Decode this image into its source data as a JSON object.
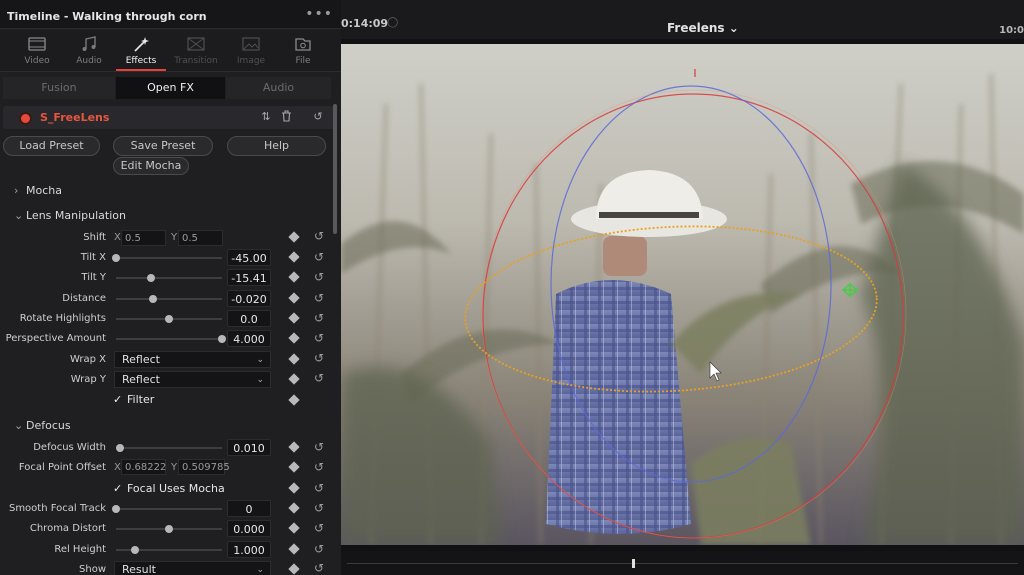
{
  "panel": {
    "title": "Timeline - Walking through corn",
    "more": "•••"
  },
  "tabs": [
    {
      "label": "Video",
      "icon": "video-icon",
      "state": "normal"
    },
    {
      "label": "Audio",
      "icon": "music-note-icon",
      "state": "normal"
    },
    {
      "label": "Effects",
      "icon": "magic-wand-icon",
      "state": "active"
    },
    {
      "label": "Transition",
      "icon": "transition-icon",
      "state": "dim"
    },
    {
      "label": "Image",
      "icon": "image-icon",
      "state": "dim"
    },
    {
      "label": "File",
      "icon": "file-icon",
      "state": "normal"
    }
  ],
  "subtabs": [
    {
      "label": "Fusion",
      "active": false
    },
    {
      "label": "Open FX",
      "active": true
    },
    {
      "label": "Audio",
      "active": false
    }
  ],
  "effect": {
    "name": "S_FreeLens"
  },
  "preset_buttons": {
    "load": "Load Preset",
    "save": "Save Preset",
    "help": "Help",
    "edit_mocha": "Edit Mocha"
  },
  "sections": {
    "mocha": "Mocha",
    "lens": "Lens Manipulation",
    "defocus": "Defocus"
  },
  "shift": {
    "label": "Shift",
    "x_label": "X",
    "x": "0.5",
    "y_label": "Y",
    "y": "0.5"
  },
  "lens_params": [
    {
      "label": "Tilt X",
      "value": "-45.00",
      "slider": 0.0
    },
    {
      "label": "Tilt Y",
      "value": "-15.41",
      "slider": 0.33
    },
    {
      "label": "Distance",
      "value": "-0.020",
      "slider": 0.35
    },
    {
      "label": "Rotate Highlights",
      "value": "0.0",
      "slider": 0.5
    },
    {
      "label": "Perspective Amount",
      "value": "4.000",
      "slider": 1.0
    }
  ],
  "wrap_x": {
    "label": "Wrap X",
    "value": "Reflect"
  },
  "wrap_y": {
    "label": "Wrap Y",
    "value": "Reflect"
  },
  "filter": {
    "label": "Filter",
    "checked": "✓"
  },
  "defocus_width": {
    "label": "Defocus Width",
    "value": "0.010",
    "slider": 0.04
  },
  "focal_offset": {
    "label": "Focal Point Offset",
    "x_label": "X",
    "x": "0.68222",
    "y_label": "Y",
    "y": "0.509785"
  },
  "focal_mocha": {
    "label": "Focal Uses Mocha",
    "checked": "✓"
  },
  "defocus_params": [
    {
      "label": "Smooth Focal Track",
      "value": "0",
      "slider": 0.0
    },
    {
      "label": "Chroma Distort",
      "value": "0.000",
      "slider": 0.5
    },
    {
      "label": "Rel Height",
      "value": "1.000",
      "slider": 0.18
    }
  ],
  "show": {
    "label": "Show",
    "value": "Result"
  },
  "viewer": {
    "timecode_left": "0:14:09",
    "clip_name": "Freelens ⌄",
    "timecode_right": "10:0"
  },
  "colors": {
    "accent_red": "#e8413a",
    "effect_name": "#e8553f",
    "overlay_orange": "#e8a020",
    "overlay_red": "#d83a3a",
    "overlay_blue": "#5a6ad8",
    "overlay_green": "#40d040"
  }
}
